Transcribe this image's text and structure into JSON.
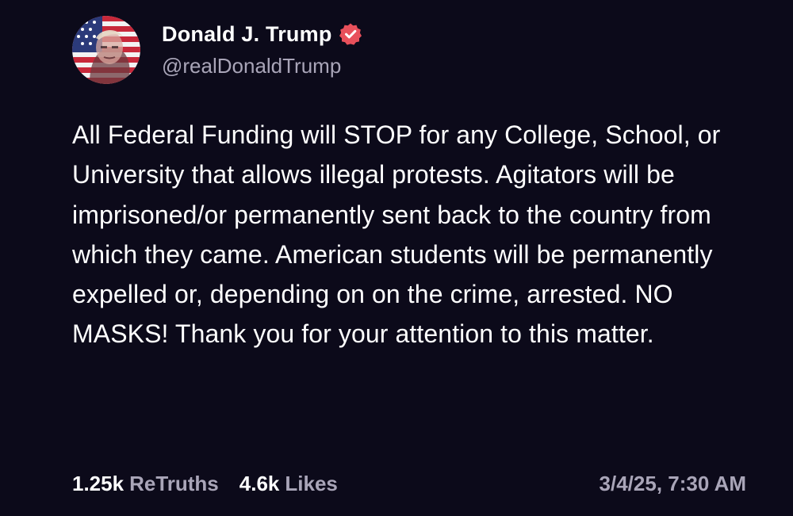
{
  "post": {
    "author": {
      "display_name": "Donald J. Trump",
      "handle": "@realDonaldTrump",
      "verified": true,
      "verified_icon": "verified-badge-icon",
      "avatar_icon": "avatar-flag-portrait"
    },
    "body": "All Federal Funding will STOP for any College, School, or University that allows illegal protests. Agitators will be imprisoned/or permanently sent back to the country from which they came. American students will be permanently expelled or, depending on on the crime, arrested. NO MASKS! Thank you for your attention to this matter.",
    "stats": {
      "retruths_count": "1.25k",
      "retruths_label": "ReTruths",
      "likes_count": "4.6k",
      "likes_label": "Likes"
    },
    "timestamp": "3/4/25, 7:30 AM"
  },
  "colors": {
    "background": "#0c0a1a",
    "text": "#ffffff",
    "muted": "#a9a5b8",
    "verified_badge": "#e8505b"
  }
}
